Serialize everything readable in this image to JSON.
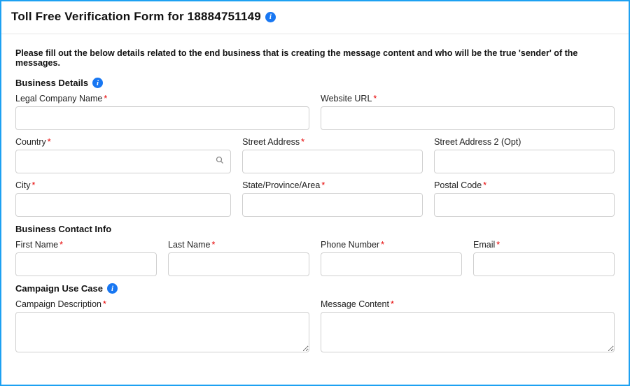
{
  "required_mark": "*",
  "header": {
    "title": "Toll Free Verification Form for 18884751149"
  },
  "instructions": "Please fill out the below details related to the end business that is creating the message content and who will be the true 'sender' of the messages.",
  "sections": {
    "business_details": "Business Details",
    "contact_info": "Business Contact Info",
    "campaign": "Campaign Use Case"
  },
  "business": {
    "legal_name": {
      "label": "Legal Company Name",
      "value": ""
    },
    "website": {
      "label": "Website URL",
      "value": ""
    },
    "country": {
      "label": "Country",
      "value": ""
    },
    "street1": {
      "label": "Street Address",
      "value": ""
    },
    "street2": {
      "label": "Street Address 2 (Opt)",
      "value": ""
    },
    "city": {
      "label": "City",
      "value": ""
    },
    "state": {
      "label": "State/Province/Area",
      "value": ""
    },
    "postal": {
      "label": "Postal Code",
      "value": ""
    }
  },
  "contact": {
    "first": {
      "label": "First Name",
      "value": ""
    },
    "last": {
      "label": "Last Name",
      "value": ""
    },
    "phone": {
      "label": "Phone Number",
      "value": ""
    },
    "email": {
      "label": "Email",
      "value": ""
    }
  },
  "campaign": {
    "description": {
      "label": "Campaign Description",
      "value": ""
    },
    "message": {
      "label": "Message Content",
      "value": ""
    }
  }
}
